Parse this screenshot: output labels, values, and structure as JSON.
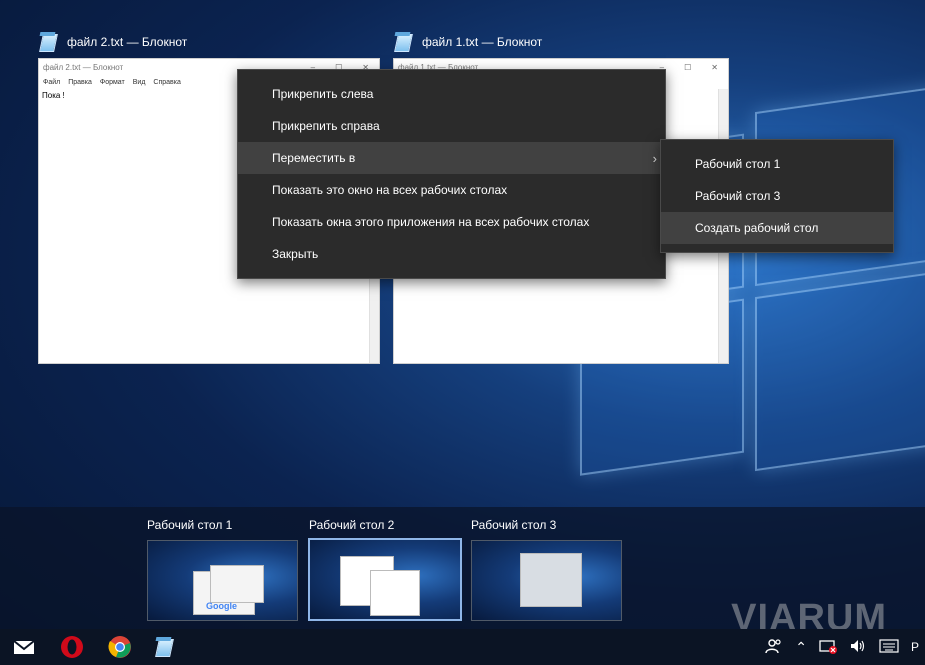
{
  "windows": [
    {
      "caption": "файл 2.txt — Блокнот",
      "thumb_title": "файл 2.txt — Блокнот",
      "menu": [
        "Файл",
        "Правка",
        "Формат",
        "Вид",
        "Справка"
      ],
      "content": "Пока !"
    },
    {
      "caption": "файл 1.txt — Блокнот",
      "thumb_title": "файл 1.txt — Блокнот"
    }
  ],
  "context_menu": {
    "items": [
      "Прикрепить слева",
      "Прикрепить справа",
      "Переместить в",
      "Показать это окно на всех рабочих столах",
      "Показать окна этого приложения на всех рабочих столах",
      "Закрыть"
    ],
    "submenu_arrow": "›"
  },
  "submenu": {
    "items": [
      "Рабочий стол 1",
      "Рабочий стол 3",
      "Создать рабочий стол"
    ]
  },
  "desktops": [
    {
      "label": "Рабочий стол 1"
    },
    {
      "label": "Рабочий стол 2",
      "selected": true
    },
    {
      "label": "Рабочий стол 3"
    }
  ],
  "google_text": "Google",
  "watermark": "VIARUM",
  "taskbar": {
    "icons": [
      "mail-icon",
      "opera-icon",
      "chrome-icon",
      "notepad-icon"
    ],
    "tray_icons": [
      "people-icon",
      "chevron-up-icon",
      "network-icon",
      "volume-icon",
      "keyboard-icon"
    ],
    "language": "Р"
  },
  "colors": {
    "menu_bg": "#2b2b2b",
    "menu_highlight": "#414141",
    "taskbar_bg": "#0b1424",
    "selected_desktop_border": "#8fb6e8"
  }
}
